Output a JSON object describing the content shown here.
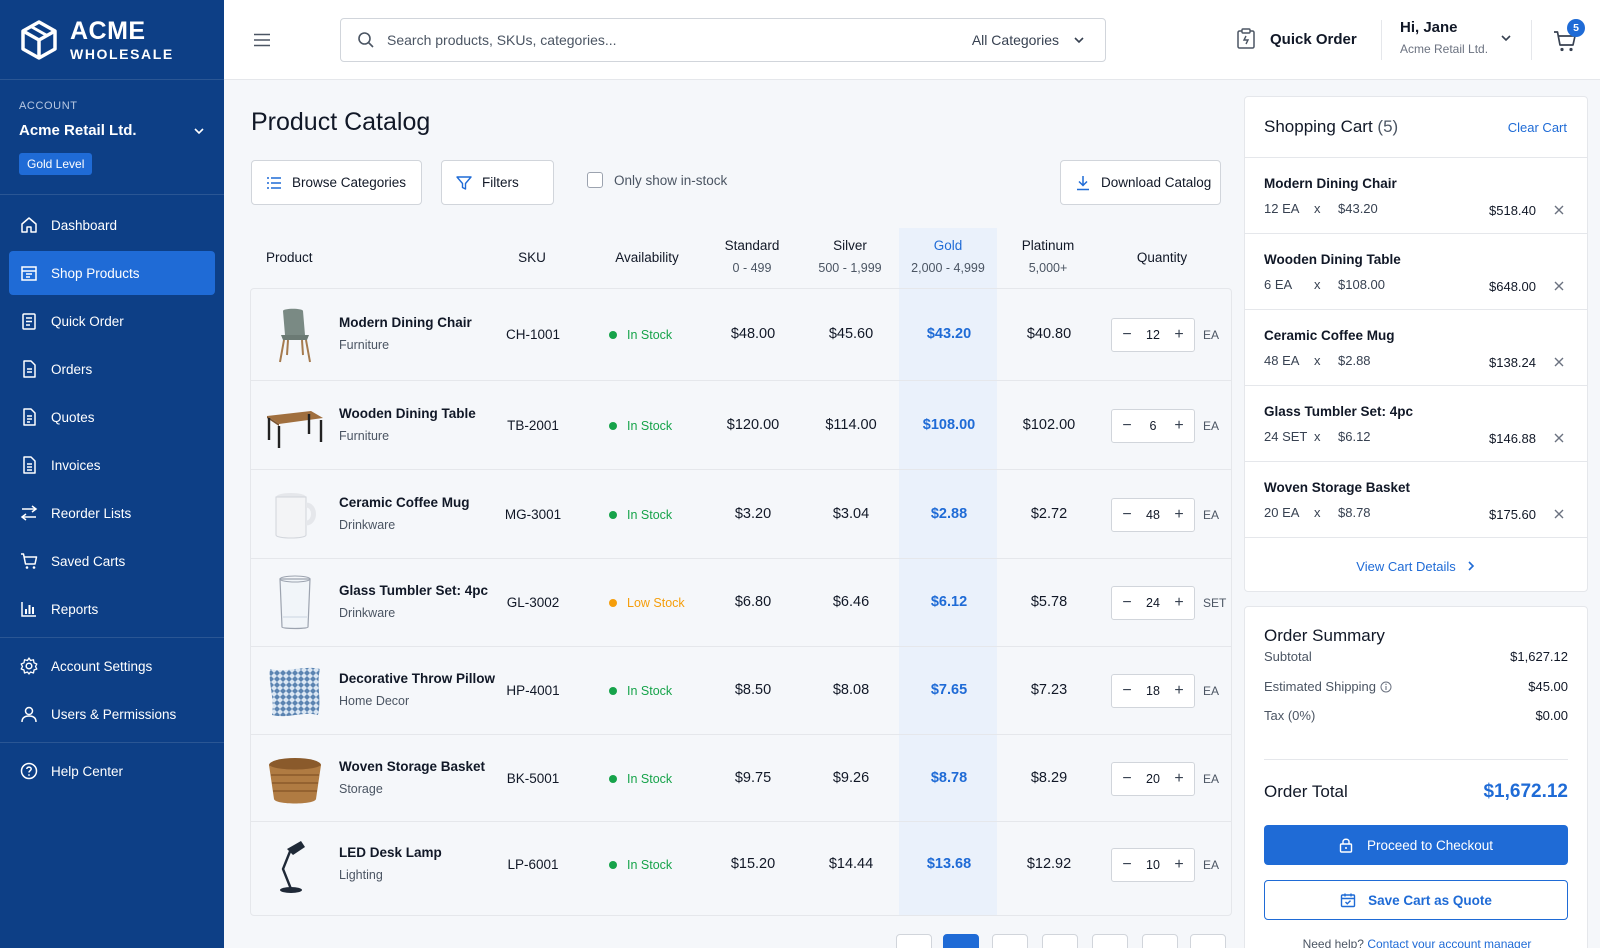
{
  "brand": {
    "name": "ACME",
    "sub": "WHOLESALE"
  },
  "account": {
    "label": "ACCOUNT",
    "name": "Acme Retail Ltd.",
    "level": "Gold Level"
  },
  "nav": {
    "items": [
      {
        "label": "Dashboard",
        "icon": "home-icon"
      },
      {
        "label": "Shop Products",
        "icon": "storefront-icon"
      },
      {
        "label": "Quick Order",
        "icon": "clipboard-icon"
      },
      {
        "label": "Orders",
        "icon": "document-icon"
      },
      {
        "label": "Quotes",
        "icon": "quote-doc-icon"
      },
      {
        "label": "Invoices",
        "icon": "invoice-icon"
      },
      {
        "label": "Reorder Lists",
        "icon": "reorder-icon"
      },
      {
        "label": "Saved Carts",
        "icon": "cart-icon"
      },
      {
        "label": "Reports",
        "icon": "bar-chart-icon"
      }
    ],
    "settings": [
      {
        "label": "Account Settings",
        "icon": "gear-icon"
      },
      {
        "label": "Users & Permissions",
        "icon": "user-icon"
      }
    ],
    "help": {
      "label": "Help Center",
      "icon": "help-icon"
    }
  },
  "topbar": {
    "search_placeholder": "Search products, SKUs, categories...",
    "category": "All Categories",
    "quick_order": "Quick Order",
    "greeting": "Hi, Jane",
    "company": "Acme Retail Ltd.",
    "cart_count": "5"
  },
  "main": {
    "title": "Product Catalog",
    "browse_label": "Browse Categories",
    "filters_label": "Filters",
    "instock_label": "Only show in-stock",
    "download_label": "Download Catalog",
    "columns": {
      "product": "Product",
      "sku": "SKU",
      "availability": "Availability",
      "standard": "Standard",
      "standard_range": "0 - 499",
      "silver": "Silver",
      "silver_range": "500 - 1,999",
      "gold": "Gold",
      "gold_range": "2,000 - 4,999",
      "platinum": "Platinum",
      "platinum_range": "5,000+",
      "quantity": "Quantity"
    },
    "products": [
      {
        "name": "Modern Dining Chair",
        "category": "Furniture",
        "sku": "CH-1001",
        "availability": "In Stock",
        "status": "in",
        "standard": "$48.00",
        "silver": "$45.60",
        "gold": "$43.20",
        "platinum": "$40.80",
        "qty": "12",
        "unit": "EA"
      },
      {
        "name": "Wooden Dining Table",
        "category": "Furniture",
        "sku": "TB-2001",
        "availability": "In Stock",
        "status": "in",
        "standard": "$120.00",
        "silver": "$114.00",
        "gold": "$108.00",
        "platinum": "$102.00",
        "qty": "6",
        "unit": "EA"
      },
      {
        "name": "Ceramic Coffee Mug",
        "category": "Drinkware",
        "sku": "MG-3001",
        "availability": "In Stock",
        "status": "in",
        "standard": "$3.20",
        "silver": "$3.04",
        "gold": "$2.88",
        "platinum": "$2.72",
        "qty": "48",
        "unit": "EA"
      },
      {
        "name": "Glass Tumbler Set: 4pc",
        "category": "Drinkware",
        "sku": "GL-3002",
        "availability": "Low Stock",
        "status": "low",
        "standard": "$6.80",
        "silver": "$6.46",
        "gold": "$6.12",
        "platinum": "$5.78",
        "qty": "24",
        "unit": "SET"
      },
      {
        "name": "Decorative Throw Pillow",
        "category": "Home Decor",
        "sku": "HP-4001",
        "availability": "In Stock",
        "status": "in",
        "standard": "$8.50",
        "silver": "$8.08",
        "gold": "$7.65",
        "platinum": "$7.23",
        "qty": "18",
        "unit": "EA"
      },
      {
        "name": "Woven Storage Basket",
        "category": "Storage",
        "sku": "BK-5001",
        "availability": "In Stock",
        "status": "in",
        "standard": "$9.75",
        "silver": "$9.26",
        "gold": "$8.78",
        "platinum": "$8.29",
        "qty": "20",
        "unit": "EA"
      },
      {
        "name": "LED Desk Lamp",
        "category": "Lighting",
        "sku": "LP-6001",
        "availability": "In Stock",
        "status": "in",
        "standard": "$15.20",
        "silver": "$14.44",
        "gold": "$13.68",
        "platinum": "$12.92",
        "qty": "10",
        "unit": "EA"
      }
    ]
  },
  "cart": {
    "title": "Shopping Cart",
    "count": "(5)",
    "clear_label": "Clear Cart",
    "x_sign": "x",
    "items": [
      {
        "name": "Modern Dining Chair",
        "qty": "12 EA",
        "price": "$43.20",
        "total": "$518.40"
      },
      {
        "name": "Wooden Dining Table",
        "qty": "6 EA",
        "price": "$108.00",
        "total": "$648.00"
      },
      {
        "name": "Ceramic Coffee Mug",
        "qty": "48 EA",
        "price": "$2.88",
        "total": "$138.24"
      },
      {
        "name": "Glass Tumbler Set: 4pc",
        "qty": "24 SET",
        "price": "$6.12",
        "total": "$146.88"
      },
      {
        "name": "Woven Storage Basket",
        "qty": "20 EA",
        "price": "$8.78",
        "total": "$175.60"
      }
    ],
    "view_details": "View Cart Details"
  },
  "summary": {
    "title": "Order Summary",
    "subtotal_label": "Subtotal",
    "subtotal": "$1,627.12",
    "shipping_label": "Estimated Shipping",
    "shipping": "$45.00",
    "tax_label": "Tax (0%)",
    "tax": "$0.00",
    "total_label": "Order Total",
    "total": "$1,672.12",
    "checkout_label": "Proceed to Checkout",
    "quote_label": "Save Cart as Quote",
    "help_text": "Need help?",
    "help_link": "Contact your account manager"
  },
  "colors": {
    "sidebar": "#0d3f86",
    "accent": "#1f6bd6",
    "in_stock": "#16a34a",
    "low_stock": "#f59e0b",
    "gold_column": "#eaf1fb"
  }
}
